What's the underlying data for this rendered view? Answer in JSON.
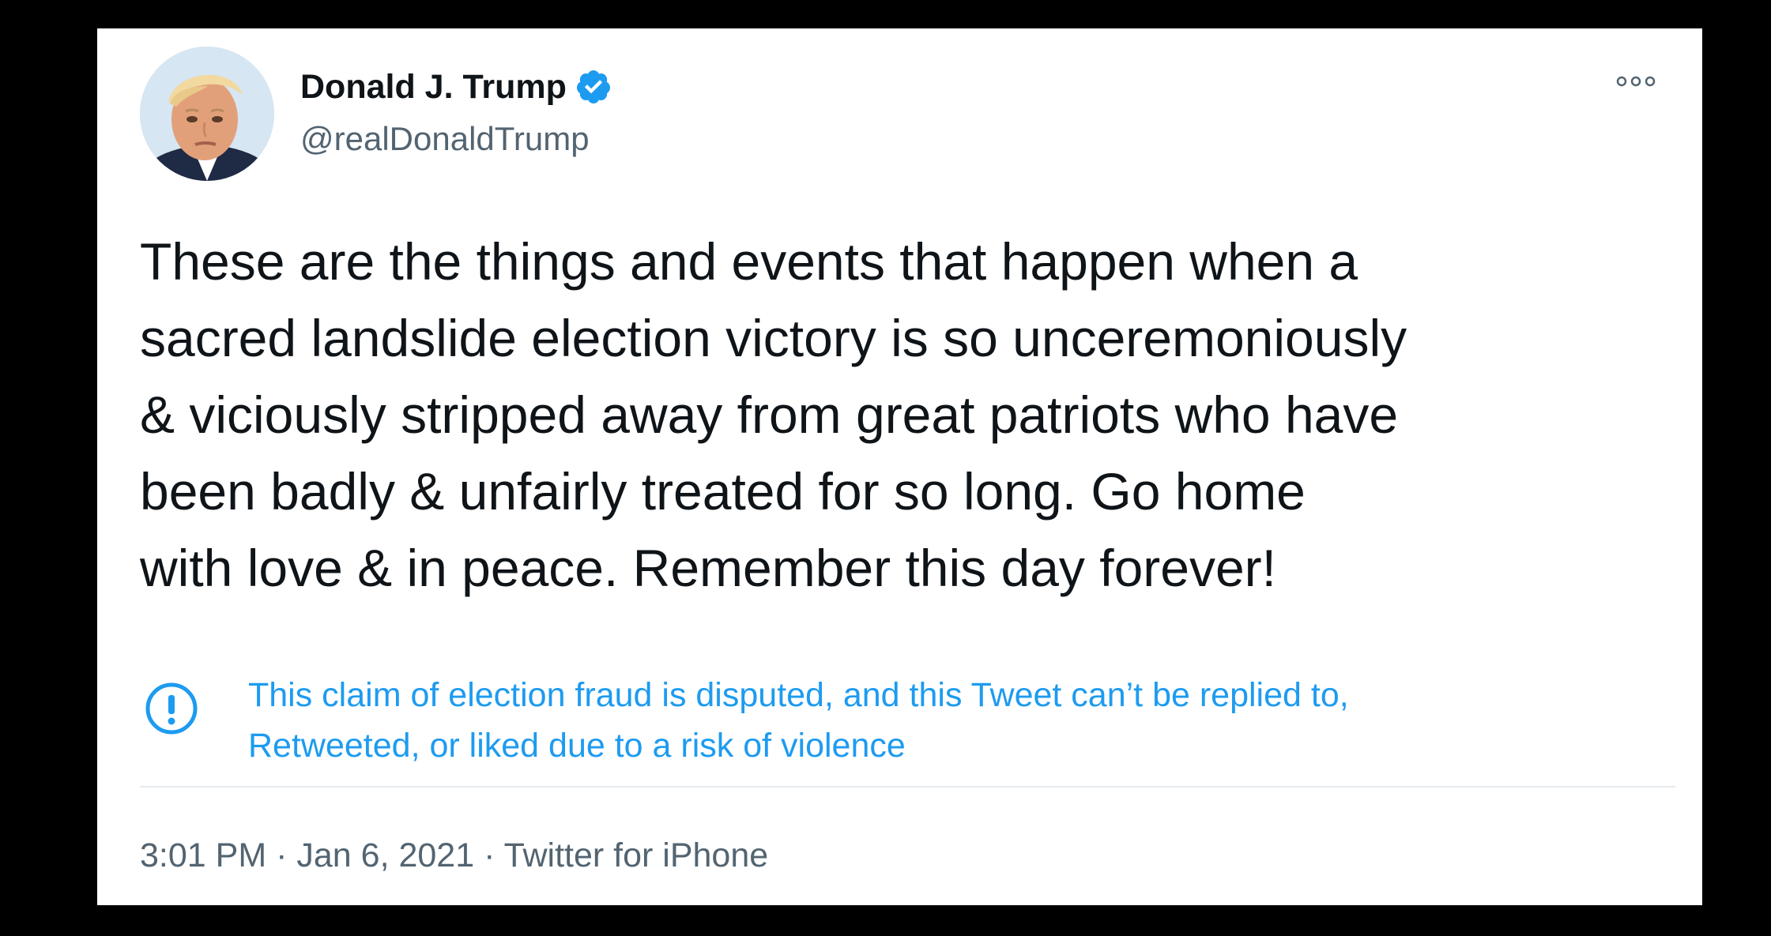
{
  "author": {
    "display_name": "Donald J. Trump",
    "handle": "@realDonaldTrump",
    "verified": true,
    "verified_icon": "verified-badge-icon"
  },
  "tweet": {
    "lines": [
      "These are the things and events that happen when a",
      "sacred landslide election victory is so unceremoniously",
      "& viciously stripped away from great patriots who have",
      "been badly & unfairly treated for so long. Go home",
      "with love & in peace. Remember this day forever!"
    ]
  },
  "notice": {
    "icon": "exclamation-circle-icon",
    "lines": [
      "This claim of election fraud is disputed, and this Tweet can’t be replied to,",
      "Retweeted, or liked due to a risk of violence"
    ]
  },
  "meta": {
    "time": "3:01 PM",
    "separator": "·",
    "date": "Jan 6, 2021",
    "source": "Twitter for iPhone"
  },
  "menu": {
    "icon": "more-options-icon"
  },
  "colors": {
    "page_background": "#000000",
    "card_background": "#ffffff",
    "accent_blue": "#1d9bf0",
    "text_primary": "#0f1419",
    "text_secondary": "#536471"
  }
}
